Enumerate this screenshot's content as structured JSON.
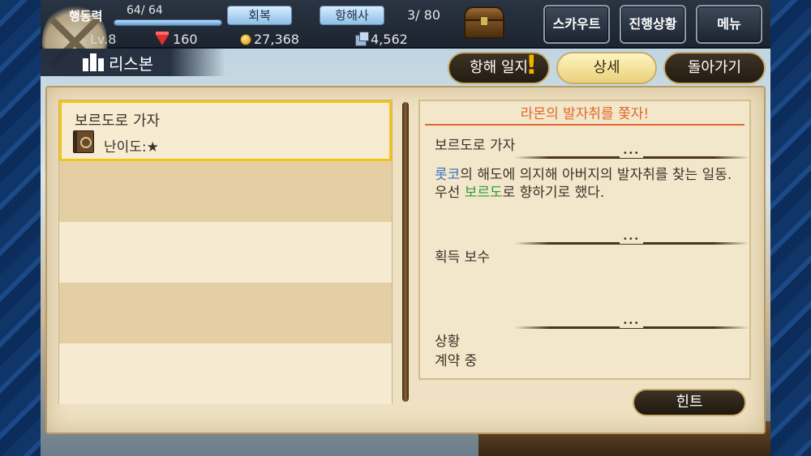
{
  "status": {
    "stamina_label": "행동력",
    "stamina_value": "64/ 64",
    "stamina_fraction": 1.0,
    "recover_label": "회복",
    "navigator_label": "항해사",
    "navigator_count": "3/ 80",
    "level": "Lv.8",
    "gems": "160",
    "gold": "27,368",
    "tickets": "4,562"
  },
  "top_buttons": {
    "scout": "스카우트",
    "progress": "진행상황",
    "menu": "메뉴"
  },
  "location": {
    "name": "리스본"
  },
  "tabs": {
    "log": "항해 일지",
    "detail": "상세",
    "back": "돌아가기"
  },
  "quest_list": {
    "items": [
      {
        "title": "보르도로 가자",
        "difficulty": "난이도:★"
      }
    ]
  },
  "detail": {
    "chapter_title": "라몬의 발자취를 쫓자!",
    "quest_name": "보르도로 가자",
    "desc_part1": "롯코",
    "desc_part2": "의 해도에 의지해 아버지의 발자취를 찾는 일동. 우선 ",
    "desc_part3": "보르도",
    "desc_part4": "로 향하기로 했다.",
    "reward_label": "획득 보수",
    "status_label": "상황",
    "status_value": "계약 중"
  },
  "hint_button": "힌트",
  "colors": {
    "accent_orange": "#e0672a",
    "selected_border": "#f2c417",
    "keyword_blue": "#3a6ec0",
    "keyword_green": "#2e9a3a"
  },
  "icons": [
    "compass-icon",
    "chest-icon",
    "gem-icon",
    "gold-coin-icon",
    "ticket-icon",
    "castle-icon",
    "book-icon"
  ]
}
